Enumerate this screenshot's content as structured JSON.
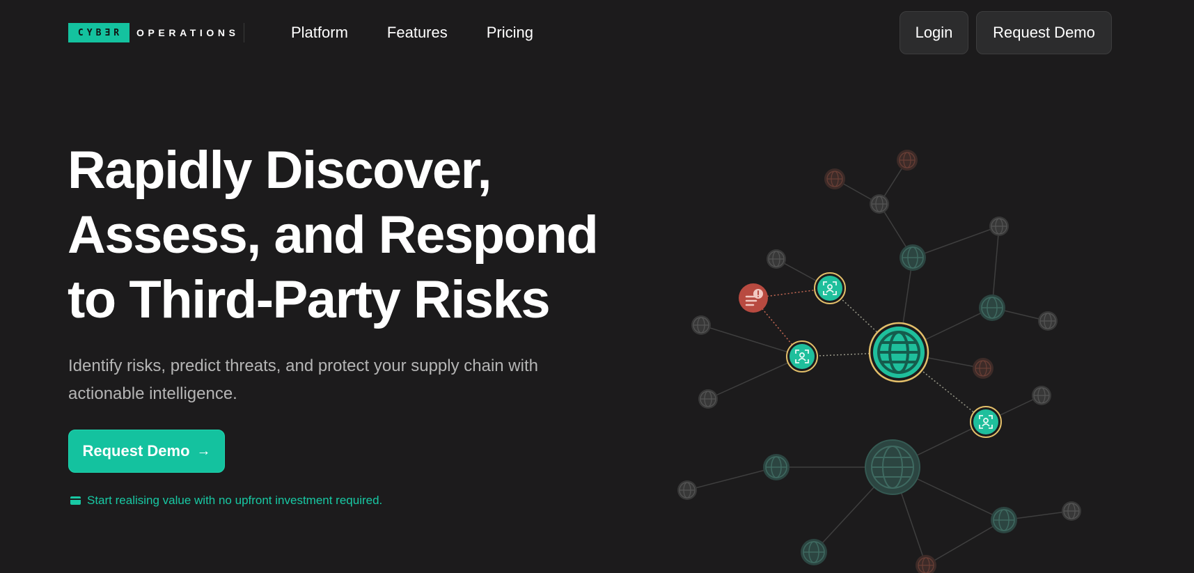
{
  "brand": {
    "box_text": "CYBƎR",
    "text": "OPERATIONS",
    "accent_color": "#14c29f"
  },
  "nav": {
    "links": [
      "Platform",
      "Features",
      "Pricing"
    ],
    "login_label": "Login",
    "demo_label": "Request Demo"
  },
  "hero": {
    "title_lines": [
      "Rapidly Discover,",
      "Assess, and Respond",
      "to Third-Party Risks"
    ],
    "subtitle_lines": [
      "Identify risks, predict threats, and protect your supply chain with",
      "actionable intelligence."
    ],
    "cta_label": "Request Demo",
    "cta_icon": "arrow-right-icon",
    "note_icon": "credit-card-icon",
    "note_text": "Start realising value with no upfront investment required."
  },
  "network": {
    "icons": [
      "globe-icon",
      "user-scan-icon",
      "alert-document-icon"
    ],
    "colors": {
      "teal": "#1fbf9c",
      "gold_ring": "#e3bf6a",
      "alert_red": "#b84a40",
      "dim_node": "#383838",
      "dim_teal_node": "#2c4541",
      "dim_red_node": "#3d2b28",
      "line": "#3f3f3f"
    }
  }
}
